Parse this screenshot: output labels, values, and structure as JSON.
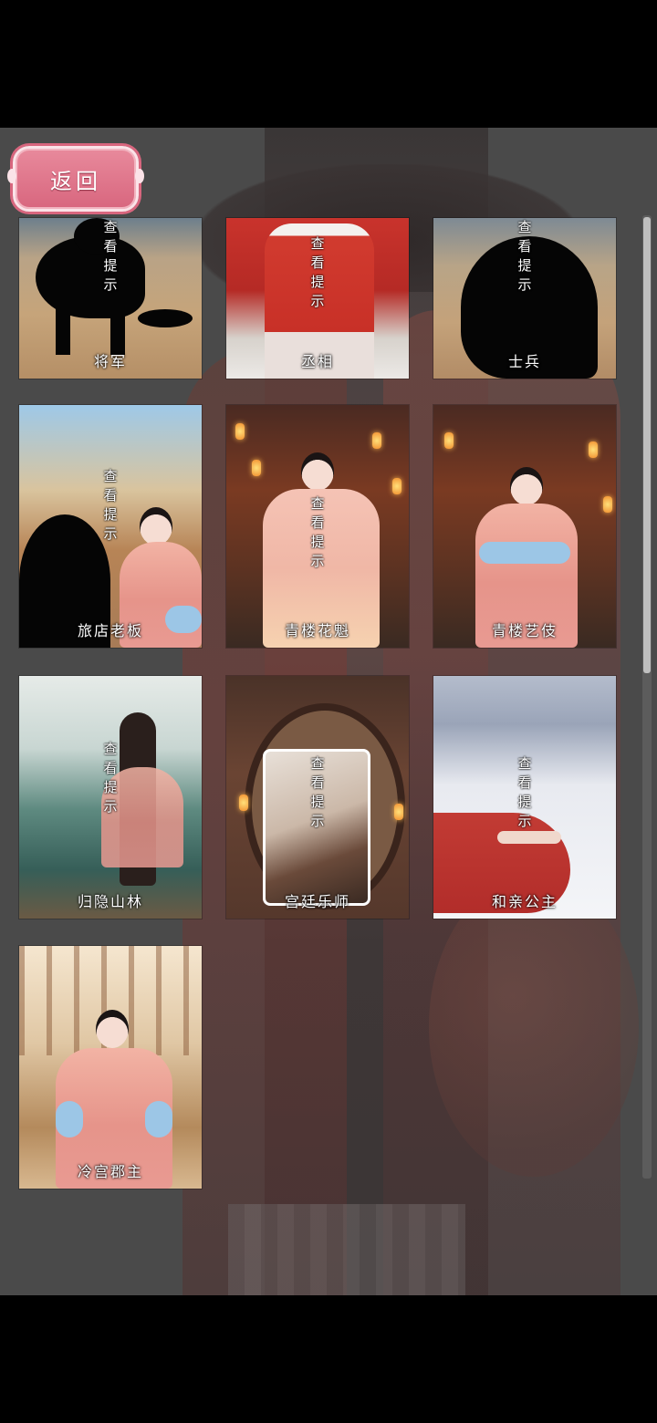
{
  "back_button": {
    "label": "返回"
  },
  "cards": [
    {
      "name": "将军",
      "hint": "查看提示"
    },
    {
      "name": "丞相",
      "hint": "查看提示"
    },
    {
      "name": "士兵",
      "hint": "查看提示"
    },
    {
      "name": "旅店老板",
      "hint": "查看提示"
    },
    {
      "name": "青楼花魁",
      "hint": "查看提示"
    },
    {
      "name": "青楼艺伎",
      "hint": ""
    },
    {
      "name": "归隐山林",
      "hint": "查看提示"
    },
    {
      "name": "宫廷乐师",
      "hint": "查看提示"
    },
    {
      "name": "和亲公主",
      "hint": "查看提示"
    },
    {
      "name": "冷宫郡主",
      "hint": ""
    }
  ],
  "colors": {
    "button_pink": "#d8667e",
    "button_border": "#fbe3e8",
    "robe_pink": "#f2b3a4",
    "sleeve_blue": "#9cc6e6"
  }
}
